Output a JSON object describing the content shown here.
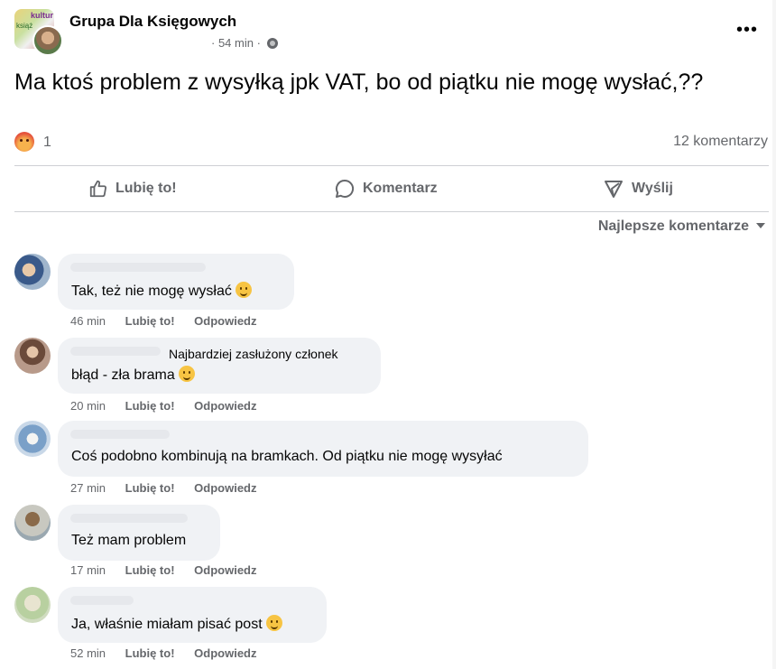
{
  "post": {
    "group_name": "Grupa Dla Księgowych",
    "time": "· 54 min ·",
    "body": "Ma ktoś problem z wysyłką jpk VAT, bo od piątku nie mogę wysłać,??",
    "reaction_count": "1",
    "comments_count": "12 komentarzy",
    "group_avatar_text_1": "kultur",
    "group_avatar_text_2": "książ"
  },
  "actions": {
    "like": "Lubię to!",
    "comment": "Komentarz",
    "send": "Wyślij"
  },
  "sort_label": "Najlepsze komentarze",
  "comments": [
    {
      "text": "Tak, też nie mogę wysłać",
      "time": "46 min",
      "like": "Lubię to!",
      "reply": "Odpowiedz",
      "emoji": "thinking"
    },
    {
      "text": "błąd - zła brama",
      "time": "20 min",
      "like": "Lubię to!",
      "reply": "Odpowiedz",
      "badge": "Najbardziej zasłużony członek",
      "emoji": "grinning"
    },
    {
      "text": "Coś podobno kombinują na bramkach. Od piątku nie mogę wysyłać",
      "time": "27 min",
      "like": "Lubię to!",
      "reply": "Odpowiedz"
    },
    {
      "text": "Też mam problem",
      "time": "17 min",
      "like": "Lubię to!",
      "reply": "Odpowiedz"
    },
    {
      "text": "Ja, właśnie miałam pisać post",
      "time": "52 min",
      "like": "Lubię to!",
      "reply": "Odpowiedz",
      "emoji": "winking"
    }
  ],
  "colors": {
    "secondary_text": "#65676b",
    "bubble": "#f0f2f5",
    "divider": "#ced0d4"
  }
}
